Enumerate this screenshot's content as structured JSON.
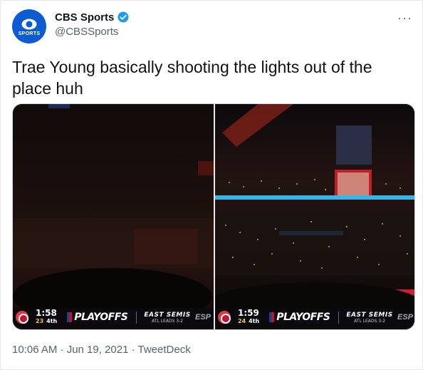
{
  "author": {
    "display_name": "CBS Sports",
    "handle": "@CBSSports",
    "avatar_text": "SPORTS",
    "brand_color": "#0b5bd3",
    "verified_color": "#1d9bf0"
  },
  "more_label": "···",
  "tweet_text": "Trae Young basically shooting the lights out of the place huh",
  "media": {
    "left": {
      "clock": "1:58",
      "score": "23",
      "quarter": "4th",
      "playoffs": "PLAYOFFS",
      "series_title": "EAST SEMIS",
      "series_status": "ATL LEADS 3-2",
      "network": "ESP"
    },
    "right": {
      "clock": "1:59",
      "score": "24",
      "quarter": "4th",
      "playoffs": "PLAYOFFS",
      "series_title": "EAST SEMIS",
      "series_status": "ATL LEADS 3-2",
      "network": "ESP"
    }
  },
  "footer": "10:06 AM · Jun 19, 2021 · TweetDeck"
}
